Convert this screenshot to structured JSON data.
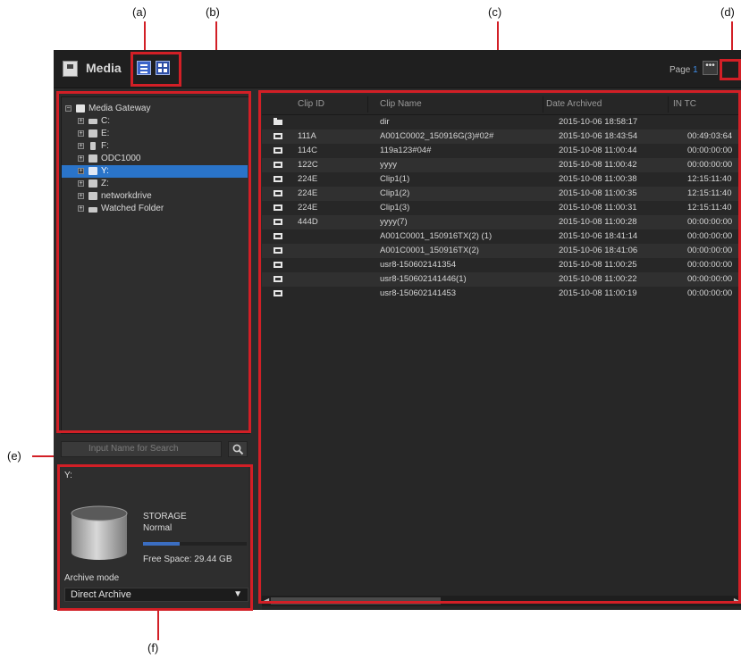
{
  "callouts": [
    "(a)",
    "(b)",
    "(c)",
    "(d)",
    "(e)",
    "(f)"
  ],
  "toolbar": {
    "title": "Media",
    "page_label": "Page",
    "page_number": "1",
    "more_label": "•••"
  },
  "tree": {
    "items": [
      {
        "label": "Media Gateway",
        "expander": "−",
        "icon": "gateway-icon"
      },
      {
        "label": "C:",
        "expander": "+",
        "icon": "drive-icon"
      },
      {
        "label": "E:",
        "expander": "+",
        "icon": "drive-icon"
      },
      {
        "label": "F:",
        "expander": "+",
        "icon": "drive-icon"
      },
      {
        "label": "ODC1000",
        "expander": "+",
        "icon": "disc-drive-icon"
      },
      {
        "label": "Y:",
        "expander": "+",
        "icon": "network-drive-icon",
        "selected": true
      },
      {
        "label": "Z:",
        "expander": "+",
        "icon": "network-drive-icon"
      },
      {
        "label": "networkdrive",
        "expander": "+",
        "icon": "network-icon"
      },
      {
        "label": "Watched Folder",
        "expander": "+",
        "icon": "watched-folder-icon"
      }
    ]
  },
  "search": {
    "placeholder": "Input Name for Search",
    "icon": "search-icon"
  },
  "storage": {
    "drive": "Y:",
    "title": "STORAGE",
    "status": "Normal",
    "usage_fraction": 0.35,
    "free_space": "Free Space: 29.44 GB",
    "archive_mode_label": "Archive mode",
    "archive_mode_value": "Direct Archive",
    "dropdown_arrow": "▼"
  },
  "table": {
    "columns": [
      "Clip ID",
      "Clip Name",
      "Date Archived",
      "IN TC"
    ],
    "rows": [
      {
        "type": "folder",
        "clip_id": "",
        "clip_name": "dir",
        "date": "2015-10-06 18:58:17",
        "in_tc": ""
      },
      {
        "type": "clip",
        "clip_id": "111A",
        "clip_name": "A001C0002_150916G(3)#02#",
        "date": "2015-10-06 18:43:54",
        "in_tc": "00:49:03:64"
      },
      {
        "type": "clip",
        "clip_id": "114C",
        "clip_name": "119a123#04#",
        "date": "2015-10-08 11:00:44",
        "in_tc": "00:00:00:00"
      },
      {
        "type": "clip",
        "clip_id": "122C",
        "clip_name": "yyyy",
        "date": "2015-10-08 11:00:42",
        "in_tc": "00:00:00:00"
      },
      {
        "type": "clip",
        "clip_id": "224E",
        "clip_name": "Clip1(1)",
        "date": "2015-10-08 11:00:38",
        "in_tc": "12:15:11:40"
      },
      {
        "type": "clip",
        "clip_id": "224E",
        "clip_name": "Clip1(2)",
        "date": "2015-10-08 11:00:35",
        "in_tc": "12:15:11:40"
      },
      {
        "type": "clip",
        "clip_id": "224E",
        "clip_name": "Clip1(3)",
        "date": "2015-10-08 11:00:31",
        "in_tc": "12:15:11:40"
      },
      {
        "type": "clip",
        "clip_id": "444D",
        "clip_name": "yyyy(7)",
        "date": "2015-10-08 11:00:28",
        "in_tc": "00:00:00:00"
      },
      {
        "type": "clip",
        "clip_id": "",
        "clip_name": "A001C0001_150916TX(2) (1)",
        "date": "2015-10-06 18:41:14",
        "in_tc": "00:00:00:00"
      },
      {
        "type": "clip",
        "clip_id": "",
        "clip_name": "A001C0001_150916TX(2)",
        "date": "2015-10-06 18:41:06",
        "in_tc": "00:00:00:00"
      },
      {
        "type": "clip",
        "clip_id": "",
        "clip_name": "usr8-150602141354",
        "date": "2015-10-08 11:00:25",
        "in_tc": "00:00:00:00"
      },
      {
        "type": "clip",
        "clip_id": "",
        "clip_name": "usr8-150602141446(1)",
        "date": "2015-10-08 11:00:22",
        "in_tc": "00:00:00:00"
      },
      {
        "type": "clip",
        "clip_id": "",
        "clip_name": "usr8-150602141453",
        "date": "2015-10-08 11:00:19",
        "in_tc": "00:00:00:00"
      }
    ]
  },
  "colors": {
    "callout_red": "#d21f26",
    "selection_blue": "#2a74c9",
    "accent_blue": "#3f8ee8"
  }
}
